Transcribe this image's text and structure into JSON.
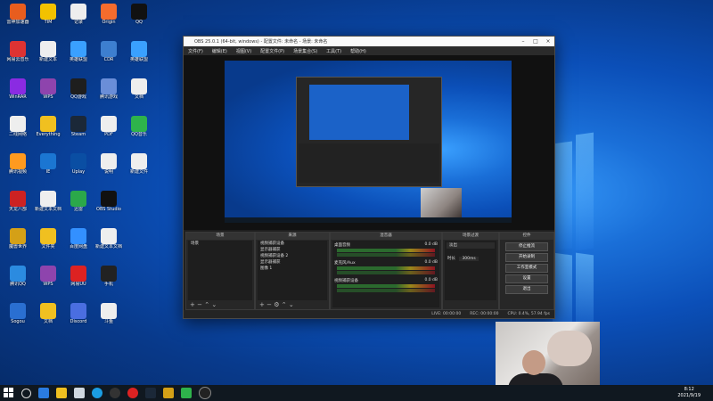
{
  "desktop_icons": [
    {
      "label": "雷神加速器",
      "color": "#e85d1e"
    },
    {
      "label": "网易云音乐",
      "color": "#d33"
    },
    {
      "label": "WinRAR",
      "color": "#8a2be2"
    },
    {
      "label": "二线网络",
      "color": "#eee"
    },
    {
      "label": "腾讯视频",
      "color": "#ff9a1f"
    },
    {
      "label": "天龙八部",
      "color": "#c22"
    },
    {
      "label": "魔兽世界",
      "color": "#d4a017"
    },
    {
      "label": "腾讯QQ",
      "color": "#2b8be0"
    },
    {
      "label": "Sogou",
      "color": "#2a6fd1"
    },
    {
      "label": "TIM",
      "color": "#f2c200"
    },
    {
      "label": "新建文本",
      "color": "#eee"
    },
    {
      "label": "WPS",
      "color": "#8e44ad"
    },
    {
      "label": "Everything",
      "color": "#f0c020"
    },
    {
      "label": "IE",
      "color": "#1b76d2"
    },
    {
      "label": "新建文本文档",
      "color": "#eee"
    },
    {
      "label": "文件夹",
      "color": "#f0c020"
    },
    {
      "label": "WPS",
      "color": "#8e44ad"
    },
    {
      "label": "文档",
      "color": "#f0c020"
    },
    {
      "label": "记录",
      "color": "#eee"
    },
    {
      "label": "英雄联盟",
      "color": "#3aa0ff"
    },
    {
      "label": "QQ游戏",
      "color": "#1e1e1e"
    },
    {
      "label": "Steam",
      "color": "#1b2838"
    },
    {
      "label": "Uplay",
      "color": "#0a4ea3"
    },
    {
      "label": "迅雷",
      "color": "#2ba84a"
    },
    {
      "label": "百度网盘",
      "color": "#3390ff"
    },
    {
      "label": "网易UU",
      "color": "#d22"
    },
    {
      "label": "Discord",
      "color": "#4a6ee0"
    },
    {
      "label": "Origin",
      "color": "#f56c2d"
    },
    {
      "label": "CDR",
      "color": "#3d7fd0"
    },
    {
      "label": "腾讯游戏",
      "color": "#6a8ed8"
    },
    {
      "label": "PDF",
      "color": "#eee"
    },
    {
      "label": "说明",
      "color": "#eee"
    },
    {
      "label": "OBS Studio",
      "color": "#111"
    },
    {
      "label": "新建文本文档",
      "color": "#eee"
    },
    {
      "label": "手机",
      "color": "#222"
    },
    {
      "label": "斗鱼",
      "color": "#eee"
    },
    {
      "label": "QQ",
      "color": "#111"
    },
    {
      "label": "英雄联盟",
      "color": "#3aa0ff"
    },
    {
      "label": "文档",
      "color": "#eee"
    },
    {
      "label": "QQ音乐",
      "color": "#2eb34b"
    },
    {
      "label": "新建文件",
      "color": "#eee"
    },
    {
      "label": "战网",
      "color": "#f08a24"
    },
    {
      "label": "录屏",
      "color": "#333"
    }
  ],
  "obs": {
    "title": "OBS 25.0.1 (64-bit, windows) - 配置文件: 未命名 - 场景: 未命名",
    "menu": [
      "文件(F)",
      "编辑(E)",
      "视图(V)",
      "配置文件(P)",
      "场景集合(S)",
      "工具(T)",
      "帮助(H)"
    ],
    "docks": {
      "scenes": {
        "title": "场景",
        "items": [
          "场景"
        ]
      },
      "sources": {
        "title": "来源",
        "items": [
          "视频捕获设备",
          "显示器捕获",
          "视频捕获设备 2",
          "显示器捕获",
          "图像 1"
        ]
      },
      "mixer": {
        "title": "混音器",
        "channels": [
          "桌面音频",
          "麦克风/Aux",
          "视频捕获设备"
        ],
        "db": "0.0 dB"
      },
      "transitions": {
        "title": "场景过渡",
        "type": "淡出",
        "duration_label": "时长",
        "duration": "300ms"
      },
      "controls": {
        "title": "控件",
        "buttons": [
          "停止推流",
          "开始录制",
          "工作室模式",
          "设置",
          "退出"
        ]
      }
    },
    "status": {
      "live": "LIVE: 00:00:00",
      "rec": "REC: 00:00:00",
      "cpu": "CPU: 0.4%, 57.94 fps"
    }
  },
  "taskbar": {
    "time": "8:12",
    "date": "2021/9/19"
  }
}
